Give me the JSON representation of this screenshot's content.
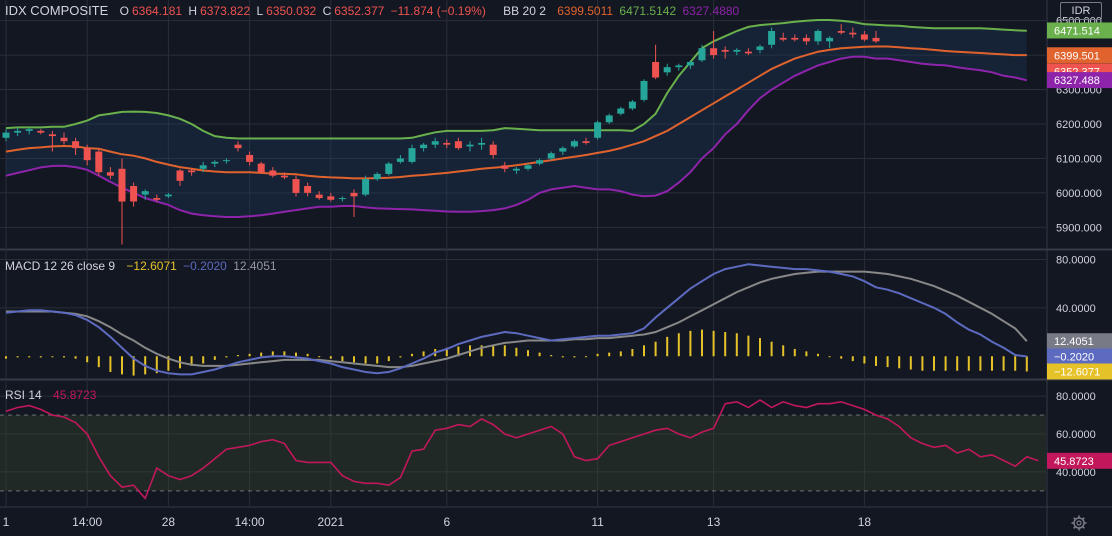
{
  "currency": "IDR",
  "legend": {
    "symbol": "IDX COMPOSITE",
    "o_label": "O",
    "o": "6364.181",
    "h_label": "H",
    "h": "6373.822",
    "l_label": "L",
    "l": "6350.032",
    "c_label": "C",
    "c": "6352.377",
    "change": "−11.874 (−0.19%)",
    "bb_label": "BB 20 2",
    "bb_mid": "6399.5011",
    "bb_upper": "6471.5142",
    "bb_lower": "6327.4880"
  },
  "macd_legend": {
    "label": "MACD 12 26 close 9",
    "v1": "−12.6071",
    "v2": "−0.2020",
    "v3": "12.4051"
  },
  "rsi_legend": {
    "label": "RSI 14",
    "value": "45.8723"
  },
  "colors": {
    "bg": "#131722",
    "grid": "#2a2e39",
    "up": "#26a69a",
    "down": "#ef5350",
    "bb_upper": "#6ab04c",
    "bb_mid": "#e0632e",
    "bb_lower": "#8e24aa",
    "macd": "#5c6bc0",
    "signal": "#888888",
    "hist": "#e6c229",
    "rsi": "#c2185b"
  },
  "chart_data": [
    {
      "type": "candlestick",
      "title": "IDX COMPOSITE",
      "ylim": [
        5840,
        6560
      ],
      "yticks": [
        5900,
        6000,
        6100,
        6200,
        6300,
        6400,
        6500
      ],
      "ytick_labels": [
        "5900.000",
        "6000.000",
        "6100.000",
        "6200.000",
        "6300.000",
        "6400.000",
        "6500.000"
      ],
      "xtick_labels": [
        {
          "i": 0,
          "label": "1"
        },
        {
          "i": 7,
          "label": "14:00"
        },
        {
          "i": 14,
          "label": "28"
        },
        {
          "i": 21,
          "label": "14:00"
        },
        {
          "i": 28,
          "label": "2021"
        },
        {
          "i": 38,
          "label": "6"
        },
        {
          "i": 51,
          "label": "11"
        },
        {
          "i": 61,
          "label": "13"
        },
        {
          "i": 74,
          "label": "18"
        }
      ],
      "price_labels": [
        {
          "v": 6471.514,
          "label": "6471.514",
          "color": "#6ab04c"
        },
        {
          "v": 6399.501,
          "label": "6399.501",
          "color": "#e0632e"
        },
        {
          "v": 6352.377,
          "label": "6352.377",
          "color": "#ef5350"
        },
        {
          "v": 6327.488,
          "label": "6327.488",
          "color": "#8e24aa"
        }
      ],
      "ohlc": [
        [
          6160,
          6185,
          6150,
          6175
        ],
        [
          6175,
          6190,
          6165,
          6180
        ],
        [
          6180,
          6190,
          6170,
          6185
        ],
        [
          6180,
          6185,
          6170,
          6175
        ],
        [
          6170,
          6180,
          6120,
          6165
        ],
        [
          6160,
          6175,
          6140,
          6150
        ],
        [
          6150,
          6160,
          6110,
          6130
        ],
        [
          6130,
          6140,
          6080,
          6095
        ],
        [
          6120,
          6130,
          6050,
          6060
        ],
        [
          6060,
          6075,
          6040,
          6050
        ],
        [
          6070,
          6100,
          5850,
          5975
        ],
        [
          6020,
          6030,
          5960,
          5975
        ],
        [
          5995,
          6010,
          5980,
          6005
        ],
        [
          5985,
          5995,
          5975,
          5980
        ],
        [
          5990,
          6000,
          5985,
          5995
        ],
        [
          6065,
          6070,
          6020,
          6035
        ],
        [
          6065,
          6070,
          6050,
          6060
        ],
        [
          6070,
          6090,
          6060,
          6080
        ],
        [
          6085,
          6095,
          6075,
          6090
        ],
        [
          6095,
          6100,
          6085,
          6095
        ],
        [
          6140,
          6150,
          6120,
          6130
        ],
        [
          6110,
          6120,
          6080,
          6090
        ],
        [
          6085,
          6090,
          6055,
          6060
        ],
        [
          6065,
          6075,
          6045,
          6050
        ],
        [
          6050,
          6060,
          6040,
          6045
        ],
        [
          6040,
          6050,
          5990,
          6000
        ],
        [
          6020,
          6030,
          5990,
          6000
        ],
        [
          5995,
          6005,
          5980,
          5985
        ],
        [
          5990,
          6000,
          5975,
          5980
        ],
        [
          5985,
          5990,
          5975,
          5985
        ],
        [
          6000,
          6010,
          5930,
          5990
        ],
        [
          5995,
          6050,
          5990,
          6040
        ],
        [
          6040,
          6060,
          6035,
          6055
        ],
        [
          6055,
          6090,
          6050,
          6085
        ],
        [
          6090,
          6110,
          6085,
          6100
        ],
        [
          6090,
          6140,
          6085,
          6130
        ],
        [
          6130,
          6145,
          6120,
          6140
        ],
        [
          6140,
          6160,
          6130,
          6150
        ],
        [
          6145,
          6155,
          6130,
          6140
        ],
        [
          6150,
          6160,
          6125,
          6130
        ],
        [
          6135,
          6150,
          6120,
          6140
        ],
        [
          6140,
          6160,
          6125,
          6145
        ],
        [
          6140,
          6150,
          6100,
          6110
        ],
        [
          6080,
          6090,
          6060,
          6070
        ],
        [
          6065,
          6075,
          6055,
          6070
        ],
        [
          6070,
          6085,
          6065,
          6080
        ],
        [
          6085,
          6100,
          6080,
          6095
        ],
        [
          6100,
          6120,
          6095,
          6115
        ],
        [
          6120,
          6135,
          6110,
          6130
        ],
        [
          6135,
          6155,
          6130,
          6150
        ],
        [
          6150,
          6160,
          6140,
          6145
        ],
        [
          6160,
          6210,
          6155,
          6205
        ],
        [
          6205,
          6230,
          6200,
          6225
        ],
        [
          6230,
          6250,
          6225,
          6245
        ],
        [
          6245,
          6270,
          6240,
          6265
        ],
        [
          6270,
          6330,
          6265,
          6325
        ],
        [
          6380,
          6430,
          6330,
          6335
        ],
        [
          6350,
          6375,
          6340,
          6365
        ],
        [
          6365,
          6375,
          6355,
          6370
        ],
        [
          6370,
          6385,
          6360,
          6380
        ],
        [
          6385,
          6430,
          6380,
          6420
        ],
        [
          6420,
          6470,
          6390,
          6400
        ],
        [
          6415,
          6425,
          6390,
          6410
        ],
        [
          6410,
          6420,
          6400,
          6415
        ],
        [
          6410,
          6420,
          6400,
          6405
        ],
        [
          6415,
          6430,
          6405,
          6425
        ],
        [
          6430,
          6480,
          6420,
          6470
        ],
        [
          6450,
          6465,
          6440,
          6445
        ],
        [
          6450,
          6460,
          6440,
          6445
        ],
        [
          6450,
          6460,
          6430,
          6440
        ],
        [
          6440,
          6475,
          6430,
          6470
        ],
        [
          6440,
          6455,
          6420,
          6450
        ],
        [
          6470,
          6490,
          6460,
          6465
        ],
        [
          6465,
          6480,
          6450,
          6460
        ],
        [
          6460,
          6470,
          6440,
          6445
        ],
        [
          6450,
          6470,
          6435,
          6440
        ]
      ],
      "bb_upper": [
        6188,
        6190,
        6190,
        6190,
        6192,
        6192,
        6200,
        6210,
        6225,
        6230,
        6235,
        6236,
        6235,
        6232,
        6225,
        6215,
        6200,
        6180,
        6165,
        6160,
        6158,
        6158,
        6158,
        6158,
        6158,
        6158,
        6158,
        6158,
        6158,
        6158,
        6158,
        6158,
        6158,
        6158,
        6158,
        6160,
        6168,
        6176,
        6180,
        6180,
        6180,
        6180,
        6182,
        6188,
        6186,
        6184,
        6182,
        6182,
        6182,
        6182,
        6182,
        6182,
        6182,
        6182,
        6180,
        6200,
        6230,
        6290,
        6340,
        6380,
        6420,
        6440,
        6455,
        6470,
        6482,
        6487,
        6490,
        6493,
        6497,
        6500,
        6502,
        6502,
        6500,
        6496,
        6490,
        6488,
        6486,
        6485,
        6482,
        6480,
        6478,
        6478,
        6478,
        6478,
        6478,
        6476,
        6474,
        6472,
        6471
      ],
      "bb_mid": [
        6120,
        6125,
        6130,
        6132,
        6135,
        6136,
        6135,
        6130,
        6128,
        6120,
        6112,
        6108,
        6100,
        6090,
        6082,
        6075,
        6070,
        6065,
        6062,
        6060,
        6060,
        6060,
        6058,
        6056,
        6055,
        6054,
        6050,
        6047,
        6045,
        6044,
        6042,
        6042,
        6043,
        6044,
        6046,
        6050,
        6052,
        6055,
        6058,
        6062,
        6066,
        6070,
        6073,
        6076,
        6080,
        6085,
        6090,
        6095,
        6100,
        6105,
        6110,
        6116,
        6122,
        6130,
        6140,
        6150,
        6165,
        6180,
        6200,
        6220,
        6240,
        6260,
        6280,
        6300,
        6320,
        6340,
        6360,
        6375,
        6390,
        6400,
        6410,
        6415,
        6420,
        6422,
        6424,
        6425,
        6425,
        6423,
        6420,
        6418,
        6415,
        6412,
        6410,
        6408,
        6406,
        6404,
        6402,
        6400,
        6400
      ],
      "bb_lower": [
        6050,
        6058,
        6066,
        6074,
        6078,
        6079,
        6075,
        6067,
        6050,
        6032,
        6015,
        6000,
        5985,
        5975,
        5965,
        5950,
        5940,
        5935,
        5932,
        5930,
        5930,
        5932,
        5935,
        5940,
        5945,
        5950,
        5955,
        5960,
        5960,
        5962,
        5962,
        5958,
        5955,
        5954,
        5953,
        5952,
        5950,
        5948,
        5946,
        5945,
        5945,
        5947,
        5950,
        5955,
        5965,
        5980,
        6000,
        6010,
        6015,
        6020,
        6015,
        6010,
        6010,
        6005,
        5995,
        5990,
        5992,
        6005,
        6030,
        6060,
        6100,
        6130,
        6170,
        6200,
        6240,
        6275,
        6300,
        6320,
        6340,
        6355,
        6370,
        6380,
        6390,
        6395,
        6395,
        6390,
        6390,
        6385,
        6380,
        6375,
        6372,
        6370,
        6365,
        6360,
        6356,
        6350,
        6340,
        6335,
        6327
      ]
    },
    {
      "type": "line",
      "title": "MACD 12 26 close 9",
      "ylim": [
        -18,
        87
      ],
      "yticks": [
        40,
        80
      ],
      "ytick_labels": [
        "40.0000",
        "80.0000"
      ],
      "price_labels": [
        {
          "v": 12.4051,
          "label": "12.4051",
          "color": "#787b86"
        },
        {
          "v": -0.202,
          "label": "−0.2020",
          "color": "#5c6bc0"
        },
        {
          "v": -12.6071,
          "label": "−12.6071",
          "color": "#e6c229"
        }
      ],
      "series": [
        {
          "key": "macd",
          "values": [
            36,
            37,
            38,
            38,
            37,
            36,
            34,
            30,
            24,
            16,
            7,
            -2,
            -8,
            -12,
            -14,
            -15,
            -15,
            -13,
            -11,
            -8,
            -5,
            -3,
            -1,
            0,
            0,
            -1,
            -2,
            -4,
            -6,
            -9,
            -11,
            -13,
            -14,
            -13,
            -10,
            -6,
            -2,
            3,
            6,
            10,
            13,
            16,
            18,
            20,
            19,
            17,
            15,
            13,
            14,
            15,
            16,
            17,
            17,
            18,
            19,
            23,
            32,
            40,
            48,
            56,
            62,
            68,
            72,
            74,
            76,
            75,
            74,
            73,
            72,
            72,
            71,
            70,
            68,
            66,
            62,
            57,
            55,
            52,
            48,
            44,
            40,
            35,
            28,
            22,
            18,
            12,
            7,
            1,
            -0.2
          ]
        },
        {
          "key": "signal",
          "values": [
            37,
            37,
            37,
            37,
            37,
            36,
            35,
            33,
            29,
            24,
            18,
            13,
            7,
            2,
            -2,
            -5,
            -7,
            -8,
            -8,
            -8,
            -7,
            -6,
            -5,
            -4,
            -3,
            -3,
            -3,
            -3,
            -4,
            -5,
            -6,
            -7,
            -8,
            -9,
            -9,
            -8,
            -6,
            -4,
            -2,
            1,
            4,
            7,
            9,
            11,
            12,
            13,
            13,
            13,
            13,
            14,
            14,
            15,
            15,
            16,
            17,
            18,
            20,
            24,
            28,
            33,
            38,
            43,
            48,
            53,
            57,
            61,
            64,
            66,
            68,
            69,
            70,
            70,
            70,
            70,
            70,
            69,
            68,
            66,
            64,
            61,
            58,
            54,
            50,
            45,
            40,
            35,
            29,
            23,
            12.4
          ]
        },
        {
          "key": "hist",
          "values": [
            -2,
            -1,
            -1,
            -1,
            0,
            -1,
            -2,
            -5,
            -9,
            -13,
            -15,
            -16,
            -15,
            -14,
            -12,
            -10,
            -8,
            -6,
            -3,
            -1,
            1,
            2,
            3,
            4,
            4,
            3,
            2,
            0,
            -2,
            -4,
            -5,
            -6,
            -6,
            -4,
            -1,
            2,
            4,
            6,
            7,
            8,
            9,
            9,
            9,
            9,
            7,
            5,
            3,
            1,
            -1,
            -1,
            0,
            2,
            3,
            4,
            6,
            9,
            12,
            16,
            19,
            21,
            22,
            21,
            20,
            19,
            17,
            15,
            12,
            9,
            6,
            4,
            2,
            0,
            -2,
            -4,
            -6,
            -8,
            -9,
            -10,
            -11,
            -12,
            -12,
            -12,
            -12,
            -12,
            -12,
            -12,
            -12,
            -12,
            -12.6
          ]
        }
      ]
    },
    {
      "type": "line",
      "title": "RSI 14",
      "ylim": [
        22,
        88
      ],
      "yticks": [
        40,
        60,
        80
      ],
      "ytick_labels": [
        "40.0000",
        "60.0000",
        "80.0000"
      ],
      "bands": [
        30,
        70
      ],
      "price_labels": [
        {
          "v": 45.8723,
          "label": "45.8723",
          "color": "#c2185b"
        }
      ],
      "series": [
        {
          "key": "rsi",
          "values": [
            72,
            74,
            75,
            73,
            70,
            69,
            66,
            60,
            48,
            38,
            32,
            33,
            26,
            42,
            38,
            36,
            38,
            42,
            47,
            52,
            53,
            54,
            56,
            57,
            55,
            46,
            45,
            45,
            45,
            38,
            35,
            34,
            34,
            33,
            37,
            51,
            52,
            62,
            63,
            65,
            64,
            68,
            65,
            60,
            58,
            60,
            62,
            64,
            60,
            48,
            46,
            47,
            54,
            56,
            58,
            60,
            62,
            63,
            60,
            58,
            61,
            63,
            76,
            77,
            74,
            78,
            74,
            77,
            75,
            74,
            76,
            76,
            77,
            75,
            73,
            70,
            68,
            64,
            58,
            55,
            53,
            54,
            50,
            52,
            48,
            49,
            46,
            43,
            48,
            45.87
          ]
        }
      ]
    }
  ]
}
